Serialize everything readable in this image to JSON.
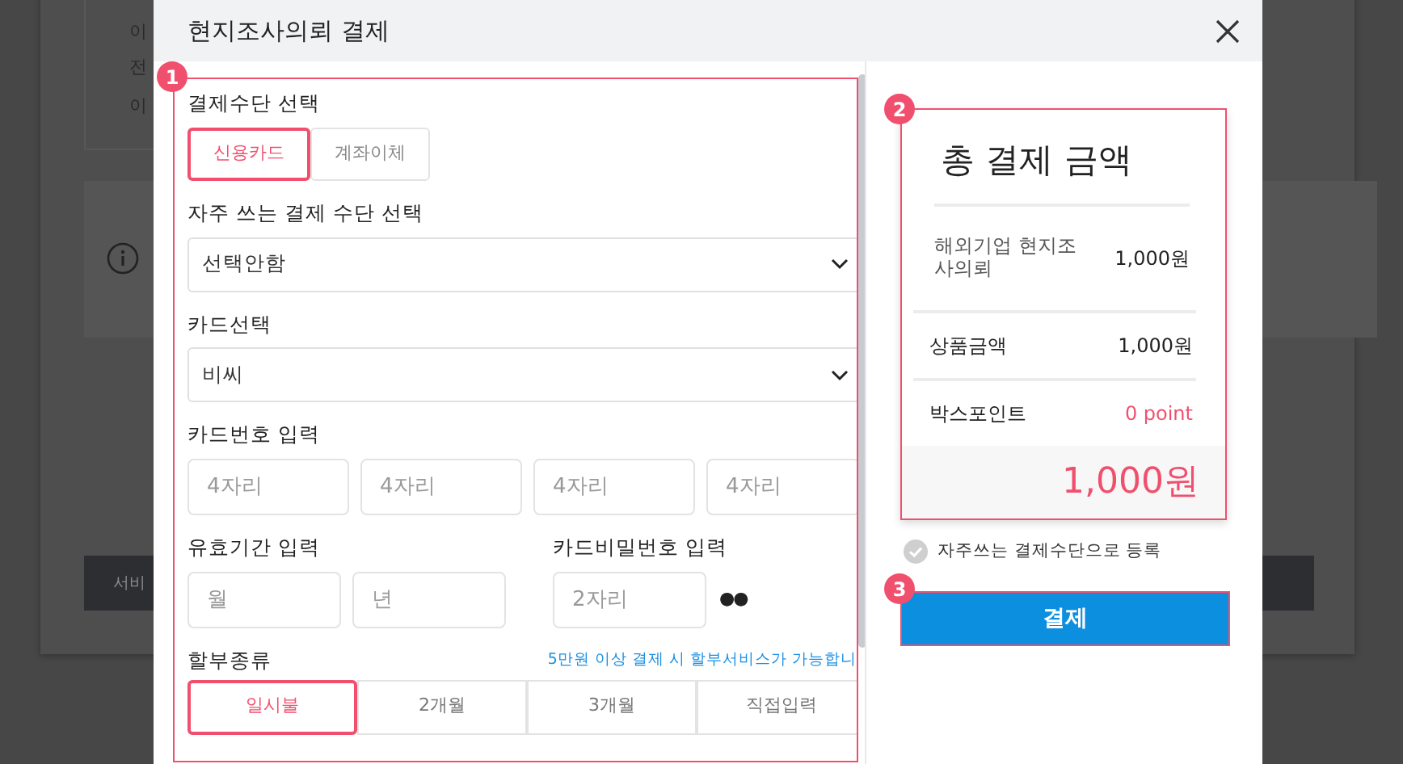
{
  "background": {
    "labels": [
      "이",
      "전",
      "이"
    ],
    "button": "서비"
  },
  "modal": {
    "title": "현지조사의뢰 결제"
  },
  "annotations": [
    {
      "number": "1"
    },
    {
      "number": "2"
    },
    {
      "number": "3"
    }
  ],
  "payment_method": {
    "label": "결제수단 선택",
    "options": [
      {
        "label": "신용카드",
        "selected": true
      },
      {
        "label": "계좌이체",
        "selected": false
      }
    ]
  },
  "favorite_method": {
    "label": "자주 쓰는 결제 수단 선택",
    "value": "선택안함"
  },
  "card_select": {
    "label": "카드선택",
    "value": "비씨"
  },
  "card_number": {
    "label": "카드번호 입력",
    "fields": [
      {
        "placeholder": "4자리"
      },
      {
        "placeholder": "4자리"
      },
      {
        "placeholder": "4자리"
      },
      {
        "placeholder": "4자리"
      }
    ]
  },
  "expiry": {
    "label": "유효기간 입력",
    "fields": [
      {
        "placeholder": "월"
      },
      {
        "placeholder": "년"
      }
    ]
  },
  "password": {
    "label": "카드비밀번호 입력",
    "placeholder": "2자리",
    "mask": "●●"
  },
  "installment": {
    "label": "할부종류",
    "note": "5만원 이상 결제 시 할부서비스가 가능합니",
    "options": [
      {
        "label": "일시불",
        "selected": true
      },
      {
        "label": "2개월",
        "selected": false
      },
      {
        "label": "3개월",
        "selected": false
      },
      {
        "label": "직접입력",
        "selected": false
      }
    ]
  },
  "summary": {
    "title": "총 결제 금액",
    "item": {
      "label": "해외기업 현지조사의뢰",
      "value": "1,000원"
    },
    "rows": [
      {
        "label": "상품금액",
        "value": "1,000원",
        "kind": "plain"
      },
      {
        "label": "박스포인트",
        "value": "0 point",
        "kind": "point"
      }
    ],
    "total": "1,000원"
  },
  "save_method": {
    "label": "자주쓰는 결제수단으로 등록",
    "checked": false
  },
  "pay_button": "결제"
}
